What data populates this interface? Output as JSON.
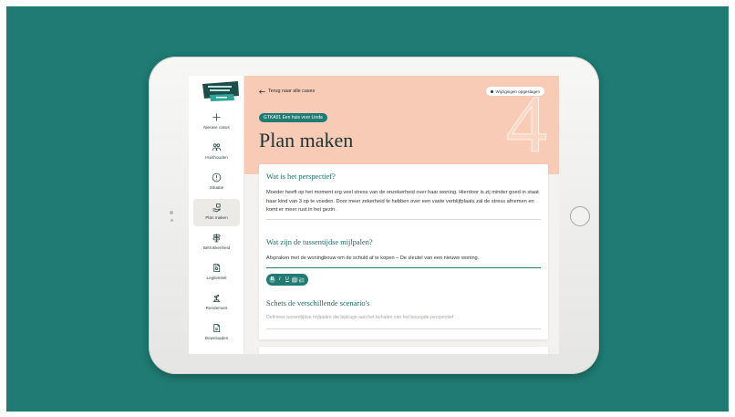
{
  "colors": {
    "page_background": "#1f7b73",
    "accent": "#1f7b73",
    "header_background": "#f8cbb7",
    "card_background": "#ffffff"
  },
  "sidebar": {
    "items": [
      {
        "label": "Nieuwe casus",
        "icon": "plus-icon",
        "active": false
      },
      {
        "label": "Huishouden",
        "icon": "people-icon",
        "active": false
      },
      {
        "label": "Situatie",
        "icon": "info-icon",
        "active": false
      },
      {
        "label": "Plan maken",
        "icon": "plan-hand-icon",
        "active": true
      },
      {
        "label": "Betrokkenheid",
        "icon": "signpost-icon",
        "active": false
      },
      {
        "label": "Legitimiteit",
        "icon": "document-seal-icon",
        "active": false
      },
      {
        "label": "Rendement",
        "icon": "plant-growth-icon",
        "active": false
      },
      {
        "label": "Downloaden",
        "icon": "file-download-icon",
        "active": false
      }
    ]
  },
  "header": {
    "back_label": "Terug naar alle cases",
    "back_icon": "arrow-left-icon",
    "save_status": "Wijzigingen opgeslagen",
    "case_badge": "GTKA01 Een huis voor Linda",
    "page_title": "Plan maken",
    "step_number": "4"
  },
  "form": {
    "sections": [
      {
        "heading": "Wat is het perspectief?",
        "value": "Moeder heeft op het moment erg veel stress van de onzekerheid over haar woning. Hierdoor is zij minder goed in staat haar kind van 3 op te voeden. Door meer zekerheid te hebben over een vaste verblijfplaats zal de stress afnemen en komt er meer rust in het gezin."
      },
      {
        "heading": "Wat zijn de tussentijdse mijlpalen?",
        "value": "Afspraken met de woningbouw om de schuld af te kopen – De sleutel van een nieuwe woning."
      },
      {
        "heading": "Schets de verschillende scenario's",
        "placeholder": "Definieer tussentijdse mijlpalen die bijdrage aan het behalen van het beoogde perspectief"
      }
    ],
    "toolbar": {
      "bold": "B",
      "italic": "I",
      "underline": "U",
      "bullet_list_icon": "bullet-list-icon",
      "numbered_list_icon": "numbered-list-icon"
    }
  }
}
